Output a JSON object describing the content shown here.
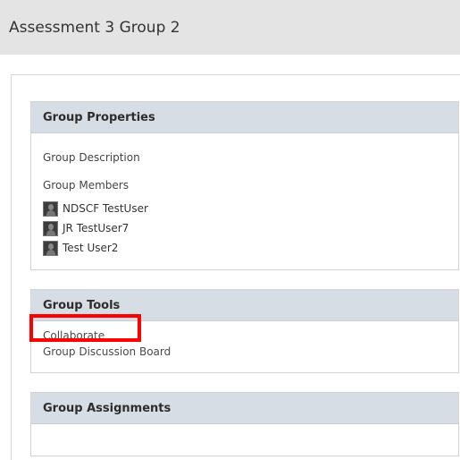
{
  "page": {
    "title": "Assessment 3 Group 2"
  },
  "group_properties": {
    "heading": "Group Properties",
    "description_label": "Group Description",
    "members_label": "Group Members",
    "members": [
      "NDSCF TestUser",
      "JR TestUser7",
      "Test User2"
    ],
    "member_icon": "user-avatar-icon"
  },
  "group_tools": {
    "heading": "Group Tools",
    "items": [
      "Collaborate",
      "Group Discussion Board"
    ]
  },
  "group_assignments": {
    "heading": "Group Assignments"
  },
  "colors": {
    "header_bg": "#e4e4e4",
    "panel_head_bg": "#d6dde5",
    "highlight": "#ff0000"
  }
}
